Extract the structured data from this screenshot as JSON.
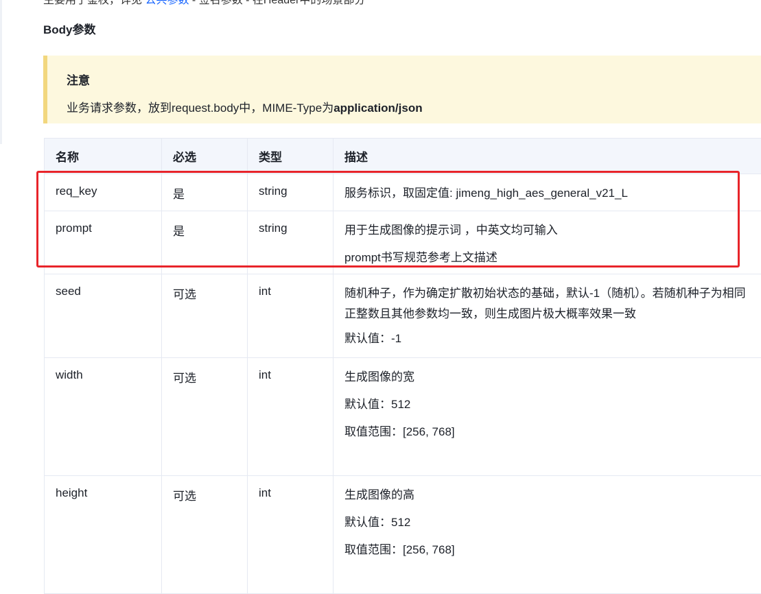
{
  "intro": {
    "prefix": "主要用于鉴权，详见 ",
    "link": "公共参数",
    "suffix": " - 签名参数 - 在Header中的场景部分"
  },
  "section_title": "Body参数",
  "note": {
    "title": "注意",
    "text_prefix": "业务请求参数，放到request.body中，MIME-Type为",
    "text_bold": "application/json"
  },
  "table": {
    "headers": [
      "名称",
      "必选",
      "类型",
      "描述"
    ],
    "rows": [
      {
        "name": "req_key",
        "required": "是",
        "type": "string",
        "desc": [
          "服务标识，取固定值: jimeng_high_aes_general_v21_L"
        ]
      },
      {
        "name": "prompt",
        "required": "是",
        "type": "string",
        "desc": [
          "用于生成图像的提示词 ，中英文均可输入",
          "prompt书写规范参考上文描述"
        ]
      },
      {
        "name": "seed",
        "required": "可选",
        "type": "int",
        "desc": [
          "随机种子，作为确定扩散初始状态的基础，默认-1（随机）。若随机种子为相同正整数且其他参数均一致，则生成图片极大概率效果一致",
          "默认值：-1"
        ]
      },
      {
        "name": "width",
        "required": "可选",
        "type": "int",
        "desc": [
          "生成图像的宽",
          "默认值：512",
          "取值范围：[256, 768]"
        ]
      },
      {
        "name": "height",
        "required": "可选",
        "type": "int",
        "desc": [
          "生成图像的高",
          "默认值：512",
          "取值范围：[256, 768]"
        ]
      }
    ]
  },
  "colors": {
    "link": "#1664ff",
    "note_bg": "#fdf8de",
    "note_border": "#f2d77e",
    "header_bg": "#f3f6fc",
    "highlight": "#e8242a"
  }
}
